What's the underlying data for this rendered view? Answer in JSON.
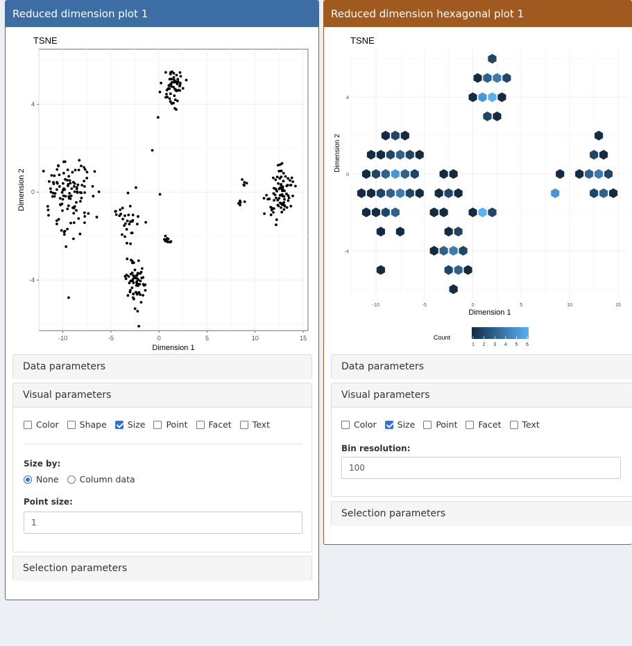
{
  "left_panel": {
    "title": "Reduced dimension plot 1",
    "plot": {
      "title": "TSNE",
      "xlabel": "Dimension 1",
      "ylabel": "Dimension 2",
      "xticks": [
        "-10",
        "-5",
        "0",
        "5",
        "10",
        "15"
      ],
      "yticks": [
        "4",
        "0",
        "-4"
      ]
    },
    "data_params": "Data parameters",
    "visual_params": "Visual parameters",
    "checks": {
      "color": "Color",
      "shape": "Shape",
      "size": "Size",
      "point": "Point",
      "facet": "Facet",
      "text": "Text"
    },
    "size_by_label": "Size by:",
    "size_by_none": "None",
    "size_by_column": "Column data",
    "point_size_label": "Point size:",
    "point_size_value": "1",
    "selection_params": "Selection parameters"
  },
  "right_panel": {
    "title": "Reduced dimension hexagonal plot 1",
    "plot": {
      "title": "TSNE",
      "xlabel": "Dimension 1",
      "ylabel": "Dimension 2",
      "xticks": [
        "-10",
        "-5",
        "0",
        "5",
        "10",
        "15"
      ],
      "yticks": [
        "4",
        "0",
        "-4"
      ]
    },
    "legend_title": "Count",
    "legend_ticks": [
      "1",
      "2",
      "3",
      "4",
      "5",
      "6"
    ],
    "data_params": "Data parameters",
    "visual_params": "Visual parameters",
    "checks": {
      "color": "Color",
      "size": "Size",
      "point": "Point",
      "facet": "Facet",
      "text": "Text"
    },
    "bin_res_label": "Bin resolution:",
    "bin_res_value": "100",
    "selection_params": "Selection parameters"
  },
  "colors": {
    "left_header": "#3c6ea5",
    "right_header": "#a0591f",
    "hex_low": "#132b43",
    "hex_high": "#56b1f7",
    "checkbox_checked": "#2f6fdf"
  },
  "chart_data": [
    {
      "type": "scatter",
      "title": "TSNE",
      "xlabel": "Dimension 1",
      "ylabel": "Dimension 2",
      "xlim": [
        -12.5,
        15.5
      ],
      "ylim": [
        -6.3,
        6.5
      ],
      "grid": true,
      "point_color": "#000000",
      "clusters": [
        {
          "center": [
            -9.3,
            -0.2
          ],
          "spread": [
            1.9,
            1.4
          ],
          "n": 110
        },
        {
          "center": [
            -2.4,
            -4.2
          ],
          "spread": [
            0.9,
            0.9
          ],
          "n": 60
        },
        {
          "center": [
            1.3,
            4.8
          ],
          "spread": [
            1.0,
            0.8
          ],
          "n": 55
        },
        {
          "center": [
            12.7,
            -0.1
          ],
          "spread": [
            1.3,
            1.1
          ],
          "n": 85
        },
        {
          "center": [
            -3.2,
            -1.2
          ],
          "spread": [
            1.3,
            0.9
          ],
          "n": 32
        },
        {
          "center": [
            0.9,
            -2.2
          ],
          "spread": [
            0.5,
            0.3
          ],
          "n": 10
        },
        {
          "center": [
            9.0,
            0.4
          ],
          "spread": [
            0.4,
            0.2
          ],
          "n": 5
        },
        {
          "center": [
            8.6,
            -0.5
          ],
          "spread": [
            0.3,
            0.2
          ],
          "n": 5
        }
      ],
      "outliers": [
        [
          -9.4,
          -4.8
        ],
        [
          -0.7,
          1.9
        ],
        [
          0.1,
          -0.1
        ],
        [
          -0.1,
          3.4
        ],
        [
          -2.1,
          -6.1
        ]
      ]
    },
    {
      "type": "heatmap",
      "subtype": "hexbin",
      "title": "TSNE",
      "xlabel": "Dimension 1",
      "ylabel": "Dimension 2",
      "xlim": [
        -12.5,
        16
      ],
      "ylim": [
        -6.5,
        6.5
      ],
      "grid": true,
      "legend": {
        "title": "Count",
        "range": [
          1,
          6
        ]
      },
      "bins": [
        [
          -9,
          -1,
          3
        ],
        [
          -8,
          -1,
          4
        ],
        [
          -10,
          0,
          2
        ],
        [
          -9,
          0,
          3
        ],
        [
          -8,
          0,
          5
        ],
        [
          -7,
          0,
          3
        ],
        [
          -10,
          1,
          1
        ],
        [
          -9,
          1,
          2
        ],
        [
          -8,
          1,
          3
        ],
        [
          -7,
          1,
          2
        ],
        [
          -11,
          -1,
          1
        ],
        [
          -10,
          -1,
          2
        ],
        [
          -7,
          -1,
          2
        ],
        [
          -10,
          -2,
          1
        ],
        [
          -9,
          -2,
          2
        ],
        [
          -8,
          -2,
          3
        ],
        [
          -11,
          -2,
          1
        ],
        [
          -9,
          2,
          1
        ],
        [
          -8,
          2,
          2
        ],
        [
          -7,
          2,
          1
        ],
        [
          -11,
          0,
          1
        ],
        [
          -6,
          0,
          2
        ],
        [
          -6,
          -1,
          1
        ],
        [
          -6,
          1,
          1
        ],
        [
          -12,
          -1,
          1
        ],
        [
          -11,
          1,
          1
        ],
        [
          -10,
          -3,
          1
        ],
        [
          -8,
          -3,
          1
        ],
        [
          -3,
          -4,
          3
        ],
        [
          -2,
          -4,
          4
        ],
        [
          -3,
          -5,
          2
        ],
        [
          -2,
          -5,
          3
        ],
        [
          -1,
          -4,
          2
        ],
        [
          -4,
          -4,
          1
        ],
        [
          -2,
          -3,
          2
        ],
        [
          -3,
          -3,
          1
        ],
        [
          -2,
          -6,
          1
        ],
        [
          1,
          5,
          3
        ],
        [
          2,
          5,
          4
        ],
        [
          1,
          4,
          5
        ],
        [
          2,
          4,
          6
        ],
        [
          3,
          5,
          2
        ],
        [
          0,
          5,
          1
        ],
        [
          2,
          6,
          2
        ],
        [
          1,
          3,
          2
        ],
        [
          2,
          3,
          1
        ],
        [
          3,
          4,
          1
        ],
        [
          0,
          4,
          1
        ],
        [
          12,
          0,
          3
        ],
        [
          13,
          0,
          4
        ],
        [
          12,
          -1,
          2
        ],
        [
          13,
          -1,
          3
        ],
        [
          14,
          0,
          2
        ],
        [
          12,
          1,
          2
        ],
        [
          13,
          1,
          1
        ],
        [
          11,
          0,
          1
        ],
        [
          14,
          -1,
          1
        ],
        [
          13,
          2,
          1
        ],
        [
          -4,
          -1,
          1
        ],
        [
          -3,
          -1,
          2
        ],
        [
          -2,
          -1,
          1
        ],
        [
          -4,
          -2,
          1
        ],
        [
          -3,
          -2,
          1
        ],
        [
          -2,
          0,
          1
        ],
        [
          -3,
          0,
          1
        ],
        [
          1,
          -2,
          6
        ],
        [
          2,
          -2,
          2
        ],
        [
          0,
          -2,
          1
        ],
        [
          8,
          -1,
          5
        ],
        [
          9,
          0,
          1
        ],
        [
          -1,
          -5,
          1
        ],
        [
          -10,
          -5,
          1
        ]
      ]
    }
  ]
}
